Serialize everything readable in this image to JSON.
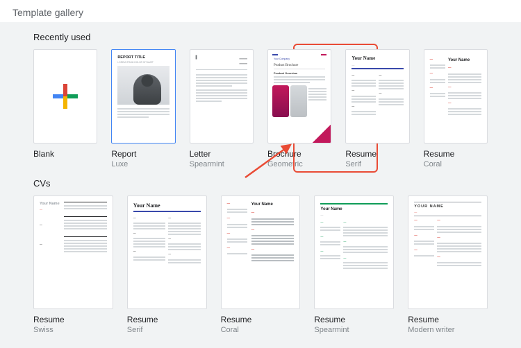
{
  "header": {
    "title": "Template gallery"
  },
  "sections": {
    "recent": {
      "title": "Recently used",
      "items": [
        {
          "name": "Blank",
          "sub": ""
        },
        {
          "name": "Report",
          "sub": "Luxe"
        },
        {
          "name": "Letter",
          "sub": "Spearmint"
        },
        {
          "name": "Brochure",
          "sub": "Geometric"
        },
        {
          "name": "Resume",
          "sub": "Serif"
        },
        {
          "name": "Resume",
          "sub": "Coral"
        }
      ]
    },
    "cvs": {
      "title": "CVs",
      "items": [
        {
          "name": "Resume",
          "sub": "Swiss"
        },
        {
          "name": "Resume",
          "sub": "Serif"
        },
        {
          "name": "Resume",
          "sub": "Coral"
        },
        {
          "name": "Resume",
          "sub": "Spearmint"
        },
        {
          "name": "Resume",
          "sub": "Modern writer"
        }
      ]
    }
  },
  "preview": {
    "report_title": "REPORT TITLE",
    "report_sub": "LOREM IPSUM DOLOR SIT AMET",
    "brochure_company": "Your Company",
    "brochure_title": "Product Brochure",
    "brochure_overview": "Product Overview",
    "your_name": "Your Name",
    "your_name_upper": "YOUR NAME"
  }
}
